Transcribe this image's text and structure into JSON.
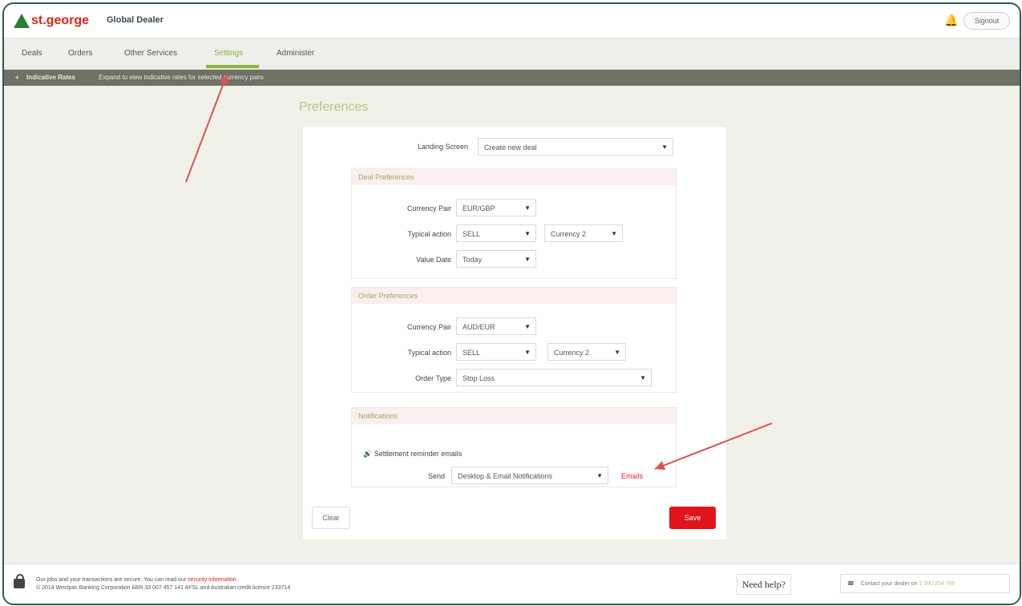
{
  "header": {
    "logo_text": "st.george",
    "app_name": "Global Dealer",
    "signout_label": "Signout"
  },
  "nav": {
    "items": [
      "Deals",
      "Orders",
      "Other Services",
      "Settings",
      "Administer"
    ],
    "active": "Settings"
  },
  "infobar": {
    "label": "Indicative Rates",
    "message": "Expand to view indicative rates for selected currency pairs"
  },
  "page": {
    "title": "Preferences"
  },
  "landing": {
    "label": "Landing Screen",
    "value": "Create new deal"
  },
  "deal_prefs": {
    "title": "Deal Preferences",
    "currency_pair_label": "Currency Pair",
    "currency_pair_value": "EUR/GBP",
    "typical_action_label": "Typical action",
    "typical_action_value": "SELL",
    "currency_value": "Currency 2",
    "value_date_label": "Value Date",
    "value_date_value": "Today"
  },
  "order_prefs": {
    "title": "Order Preferences",
    "currency_pair_label": "Currency Pair",
    "currency_pair_value": "AUD/EUR",
    "typical_action_label": "Typical action",
    "typical_action_value": "SELL",
    "currency_value": "Currency 2",
    "order_type_label": "Order Type",
    "order_type_value": "Stop Loss"
  },
  "notifications": {
    "title": "Notifications",
    "item_title": "Settlement reminder emails",
    "send_label": "Send",
    "send_value": "Desktop & Email Notifications",
    "emails_link": "Emails"
  },
  "buttons": {
    "clear": "Clear",
    "save": "Save"
  },
  "footer": {
    "line1_pre": "Our jobs and your transactions are secure. You can read our",
    "line1_link": "security information",
    "line2": "© 2014 Westpac Banking Corporation ABN 33 007 457 141 AFSL and Australian credit licence 233714",
    "help": "Need help?",
    "contact_pre": "Contact your dealer on",
    "contact_phone": "1 300 254 706"
  },
  "colors": {
    "brand_red": "#e0141b",
    "brand_green": "#8bb43a",
    "annotation": "#d9534f"
  },
  "icons": [
    "bell-icon",
    "lock-icon",
    "phone-icon",
    "speaker-icon",
    "chevron-down-icon"
  ]
}
